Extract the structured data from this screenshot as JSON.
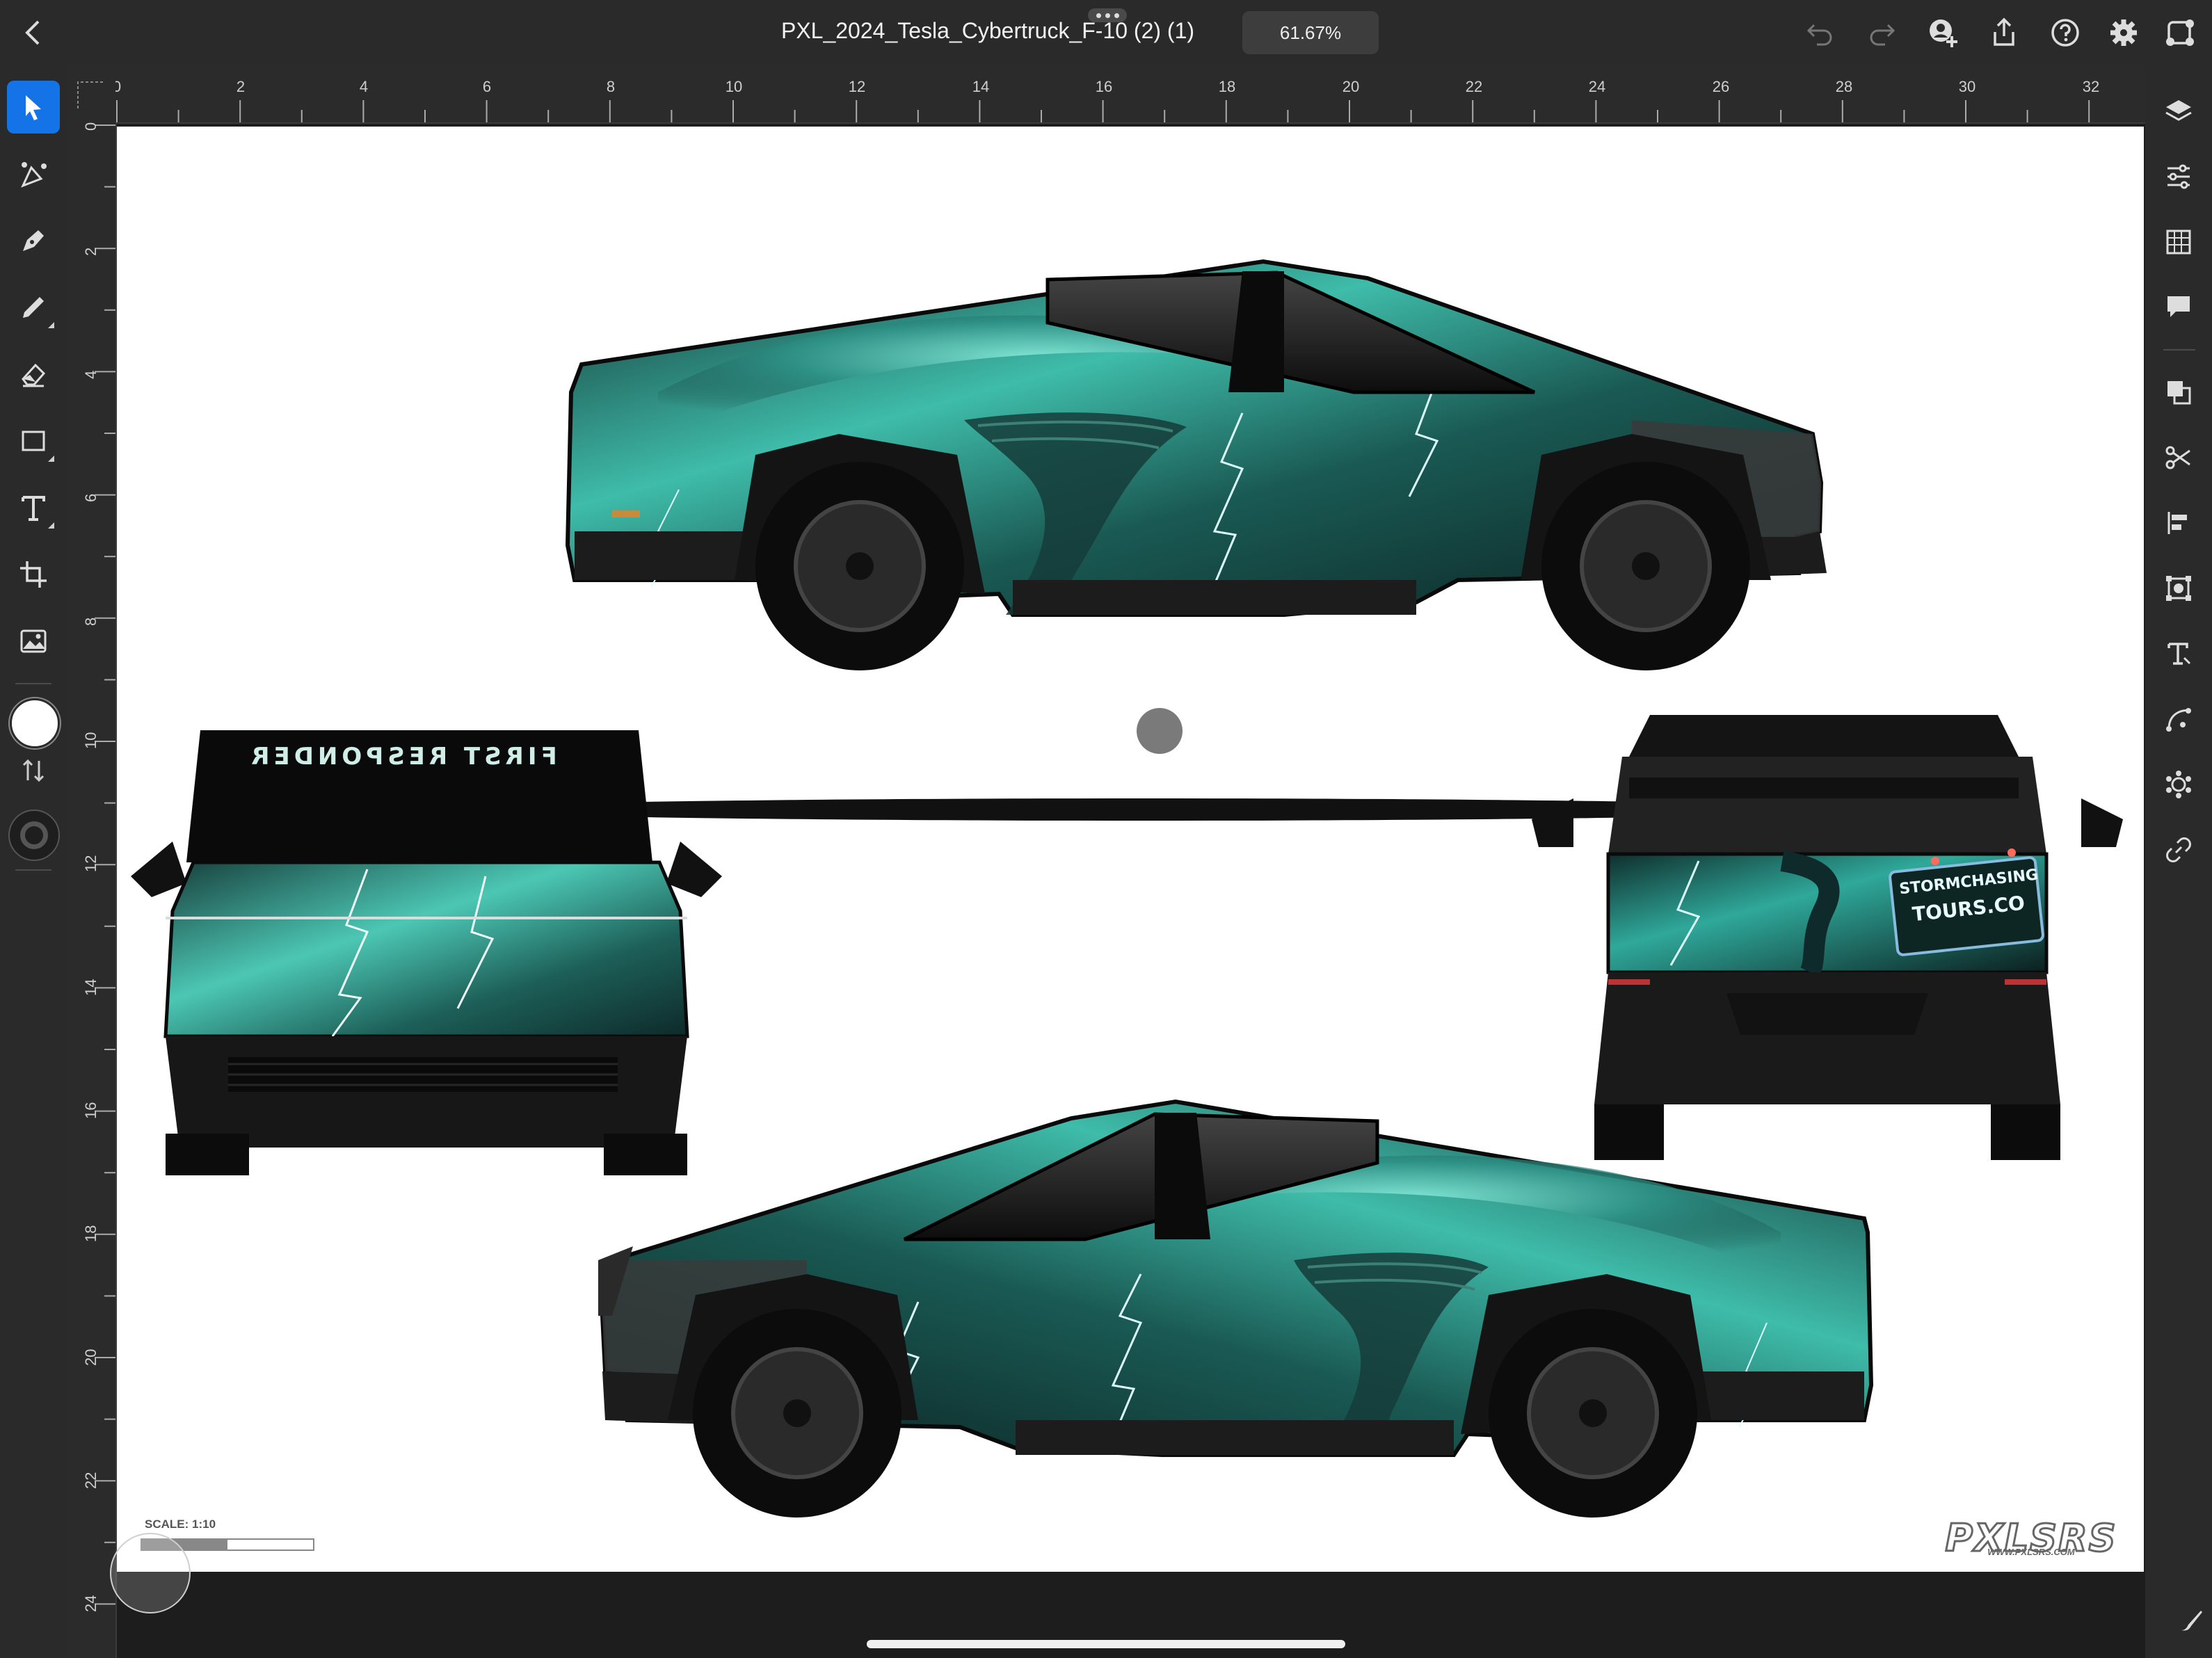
{
  "app": {
    "document_title": "PXL_2024_Tesla_Cybertruck_F-10 (2) (1)",
    "zoom_level": "61.67%"
  },
  "top_toolbar": {
    "icons": [
      "back-icon",
      "undo-icon",
      "redo-icon",
      "invite-icon",
      "share-icon",
      "help-icon",
      "settings-icon",
      "plugins-icon"
    ]
  },
  "left_toolbar": {
    "tools": [
      "selection-tool",
      "direct-selection-tool",
      "pen-tool",
      "pencil-tool",
      "eraser-tool",
      "rectangle-tool",
      "type-tool",
      "transform-tool",
      "image-tool"
    ],
    "fill_color": "#ffffff"
  },
  "right_toolbar": {
    "icons": [
      "layers-icon",
      "properties-icon",
      "libraries-icon",
      "comments-icon",
      "pathfinder-icon",
      "scissors-icon",
      "align-icon",
      "repeat-grid-icon",
      "type-icon",
      "path-icon",
      "effects-icon",
      "link-icon"
    ]
  },
  "rulers": {
    "horizontal": [
      "0",
      "2",
      "4",
      "6",
      "8",
      "10",
      "12",
      "14",
      "16",
      "18",
      "20",
      "22",
      "24",
      "26",
      "28",
      "30",
      "32"
    ],
    "vertical": [
      "0",
      "2",
      "4",
      "6",
      "8",
      "10",
      "12",
      "14",
      "16",
      "18",
      "20",
      "22",
      "24"
    ]
  },
  "artwork": {
    "front_windshield_text": "FIRST RESPONDER",
    "rear_sign_line1": "STORMCHASING",
    "rear_sign_line2": "TOURS.CO",
    "scale_label": "SCALE: 1:10",
    "logo_text": "PXLSRS",
    "logo_url": "WWW.PXLSRS.COM"
  },
  "colors": {
    "accent": "#1473e6",
    "wrap_teal": "#2fa89a",
    "wrap_dark": "#0e2a2a",
    "body_dark": "#1c1c1c"
  }
}
